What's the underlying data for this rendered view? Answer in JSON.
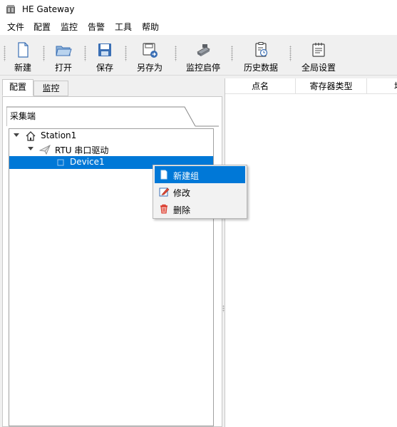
{
  "window": {
    "title": "HE Gateway"
  },
  "menu": [
    "文件",
    "配置",
    "监控",
    "告警",
    "工具",
    "帮助"
  ],
  "toolbar": {
    "new_label": "新建",
    "open_label": "打开",
    "save_label": "保存",
    "save_as_label": "另存为",
    "monitor_label": "监控启停",
    "history_label": "历史数据",
    "settings_label": "全局设置"
  },
  "tabs": {
    "config": "配置",
    "monitor": "监控"
  },
  "group": {
    "label": "采集端"
  },
  "tree": {
    "station": "Station1",
    "driver": "RTU 串口驱动",
    "device": "Device1"
  },
  "table": {
    "columns": [
      "点名",
      "寄存器类型",
      "地"
    ]
  },
  "context_menu": {
    "new_group": "新建组",
    "edit": "修改",
    "delete": "删除"
  },
  "colors": {
    "selection": "#0078d7",
    "background": "#f0f0f0"
  }
}
